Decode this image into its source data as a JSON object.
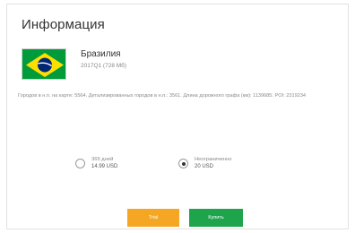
{
  "dialog": {
    "title": "Информация"
  },
  "country": {
    "name": "Бразилия",
    "meta": "2017Q1 (728 Мб)",
    "flag_icon": "brazil-flag-icon",
    "stats": "Городов в н.п. на карте: 5564. Детализированных городов в н.п.: 3561. Длина дорожного графа (км): 1139685. POI: 2319234"
  },
  "plans": [
    {
      "label": "365 дней",
      "price": "14.99 USD",
      "selected": false
    },
    {
      "label": "Неограниченно",
      "price": "20 USD",
      "selected": true
    }
  ],
  "buttons": {
    "trial_label": "Trial",
    "buy_label": "Купить"
  },
  "colors": {
    "trial": "#f5a623",
    "buy": "#1ea44b",
    "flag_green": "#009b3a",
    "flag_yellow": "#fedf00",
    "flag_blue": "#002776"
  }
}
